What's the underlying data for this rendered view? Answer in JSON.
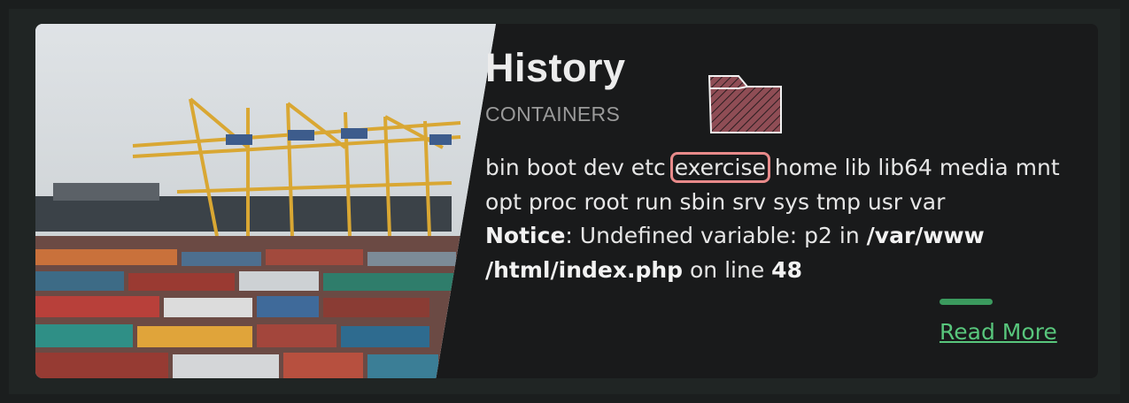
{
  "card": {
    "title": "History",
    "subtitle": "CONTAINERS",
    "folder_icon": "folder-icon",
    "image": "container-port-photo",
    "directory_list_before": "bin boot dev etc ",
    "directory_highlight": "exercise",
    "directory_list_after": " home lib lib64 media mnt opt proc root run sbin srv sys tmp usr var",
    "error": {
      "label": "Notice",
      "text_1": ": Undefined variable: p2 in ",
      "path": "/var/www /html/index.php",
      "text_2": " on line ",
      "line": "48"
    },
    "read_more": "Read More",
    "colors": {
      "accent_green": "#58c67c",
      "accent_bar": "#3b9a5e",
      "highlight_border": "#e88a8a",
      "card_bg": "#191a1b"
    }
  }
}
